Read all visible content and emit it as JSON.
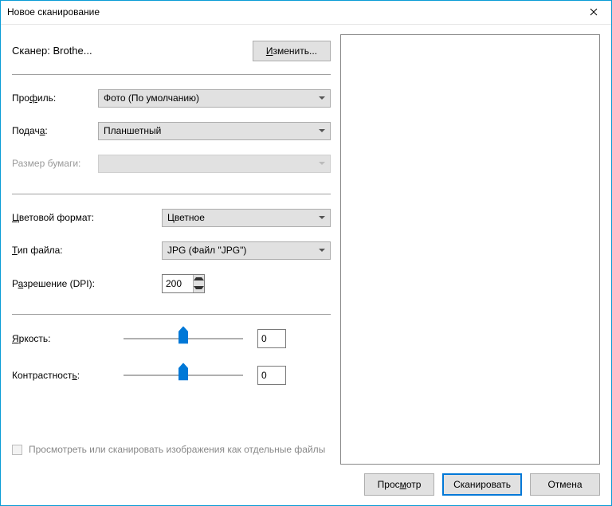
{
  "window": {
    "title": "Новое сканирование"
  },
  "scanner": {
    "prefix": "Сканер: ",
    "name": "Brothe...",
    "change_btn": "Изменить..."
  },
  "profile": {
    "label": "Профиль:",
    "value": "Фото (По умолчанию)"
  },
  "feeder": {
    "label": "Подача:",
    "value": "Планшетный"
  },
  "paper": {
    "label": "Размер бумаги:",
    "value": ""
  },
  "color": {
    "label": "Цветовой формат:",
    "value": "Цветное"
  },
  "filetype": {
    "label": "Тип файла:",
    "value": "JPG (Файл \"JPG\")"
  },
  "dpi": {
    "label": "Разрешение (DPI):",
    "value": "200"
  },
  "brightness": {
    "label": "Яркость:",
    "value": "0"
  },
  "contrast": {
    "label": "Контрастность:",
    "value": "0"
  },
  "separate": {
    "label": "Просмотреть или сканировать изображения как отдельные файлы"
  },
  "footer": {
    "preview": "Просмотр",
    "scan": "Сканировать",
    "cancel": "Отмена"
  }
}
